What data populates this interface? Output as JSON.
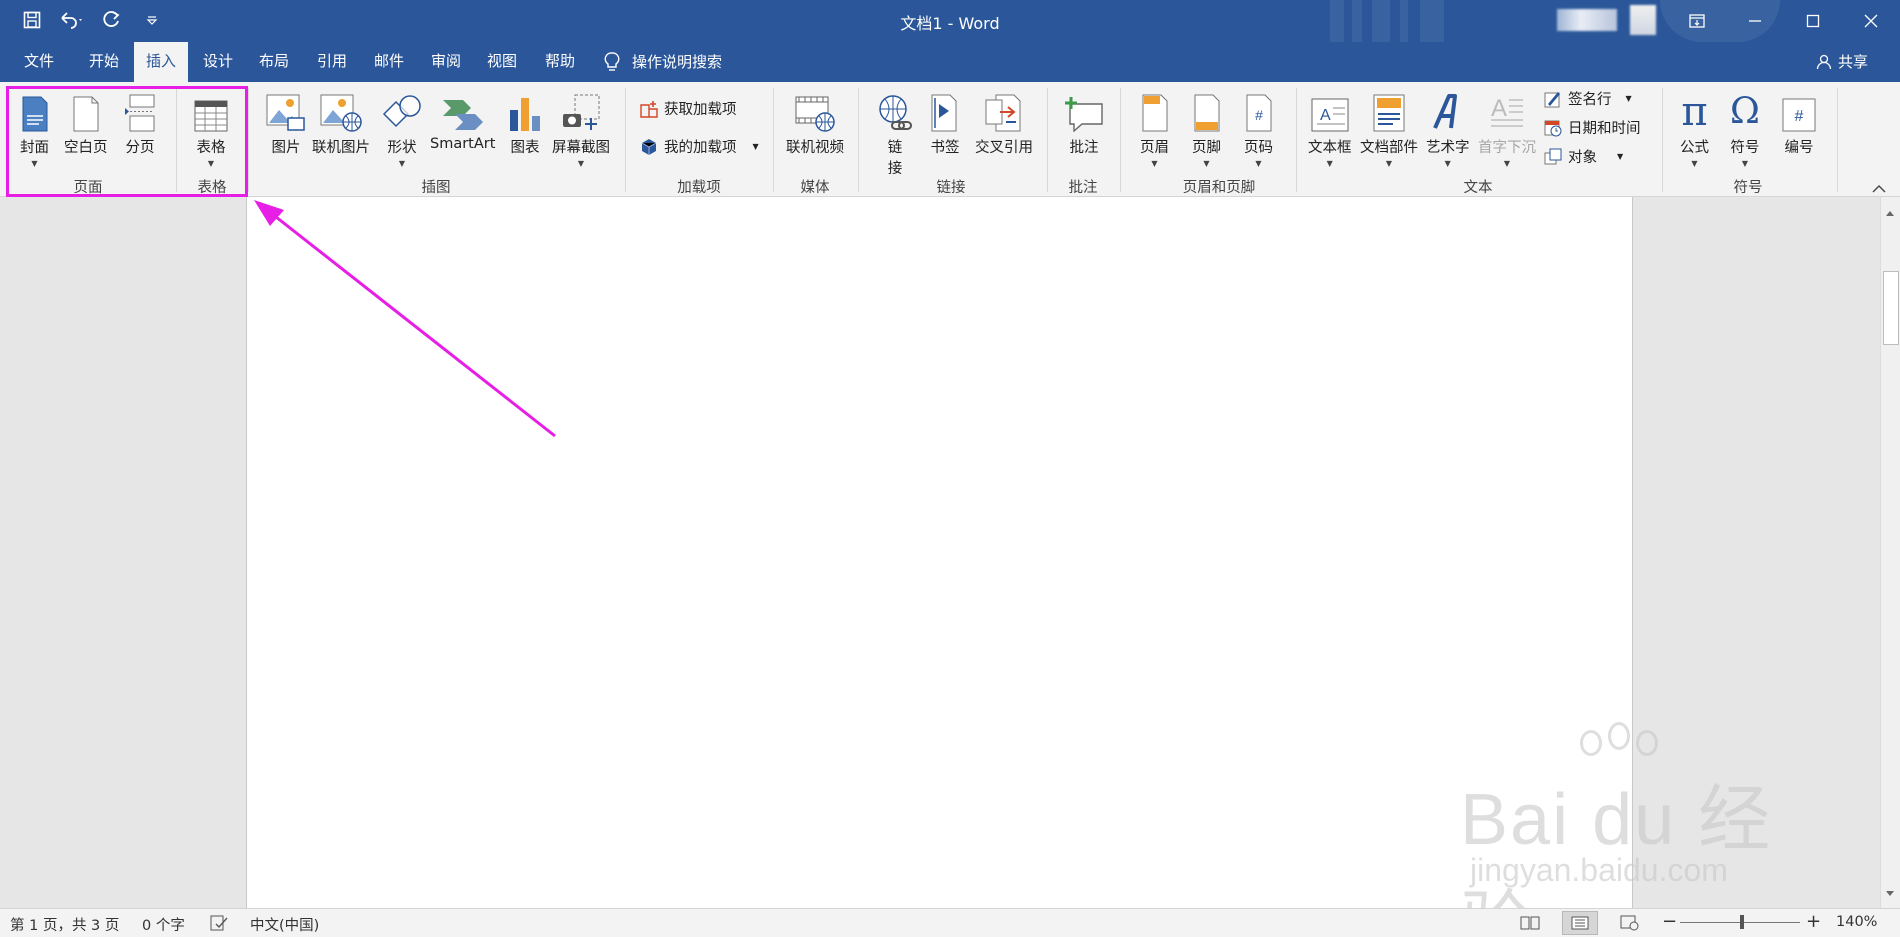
{
  "titlebar": {
    "title": "文档1  -  Word"
  },
  "tabs": [
    {
      "label": "文件"
    },
    {
      "label": "开始"
    },
    {
      "label": "插入"
    },
    {
      "label": "设计"
    },
    {
      "label": "布局"
    },
    {
      "label": "引用"
    },
    {
      "label": "邮件"
    },
    {
      "label": "审阅"
    },
    {
      "label": "视图"
    },
    {
      "label": "帮助"
    }
  ],
  "search": {
    "label": "操作说明搜索"
  },
  "share": {
    "label": "共享"
  },
  "ribbon": {
    "pages": {
      "cover": "封面",
      "blank": "空白页",
      "break": "分页",
      "group": "页面"
    },
    "tables": {
      "table": "表格",
      "group": "表格"
    },
    "illustrations": {
      "picture": "图片",
      "online_picture": "联机图片",
      "shapes": "形状",
      "smartart": "SmartArt",
      "chart": "图表",
      "screenshot": "屏幕截图",
      "group": "插图"
    },
    "addins": {
      "get": "获取加载项",
      "my": "我的加载项",
      "group": "加载项"
    },
    "media": {
      "video": "联机视频",
      "group": "媒体"
    },
    "links": {
      "link_1": "链",
      "link_2": "接",
      "bookmark": "书签",
      "cross_ref": "交叉引用",
      "group": "链接"
    },
    "comments": {
      "comment": "批注",
      "group": "批注"
    },
    "header_footer": {
      "header": "页眉",
      "footer": "页脚",
      "page_number": "页码",
      "group": "页眉和页脚"
    },
    "text": {
      "textbox": "文本框",
      "quick_parts": "文档部件",
      "wordart": "艺术字",
      "dropcap": "首字下沉",
      "signature": "签名行",
      "datetime": "日期和时间",
      "object": "对象",
      "group": "文本"
    },
    "symbols": {
      "equation": "公式",
      "symbol": "符号",
      "number": "编号",
      "group": "符号"
    }
  },
  "status": {
    "page": "第 1 页，共 3 页",
    "words": "0 个字",
    "lang": "中文(中国)",
    "zoom": "140%"
  },
  "watermark": {
    "brand": "Bai  du 经验",
    "url": "jingyan.baidu.com"
  },
  "colors": {
    "accent": "#2b579a",
    "highlight": "#e61ee6"
  }
}
